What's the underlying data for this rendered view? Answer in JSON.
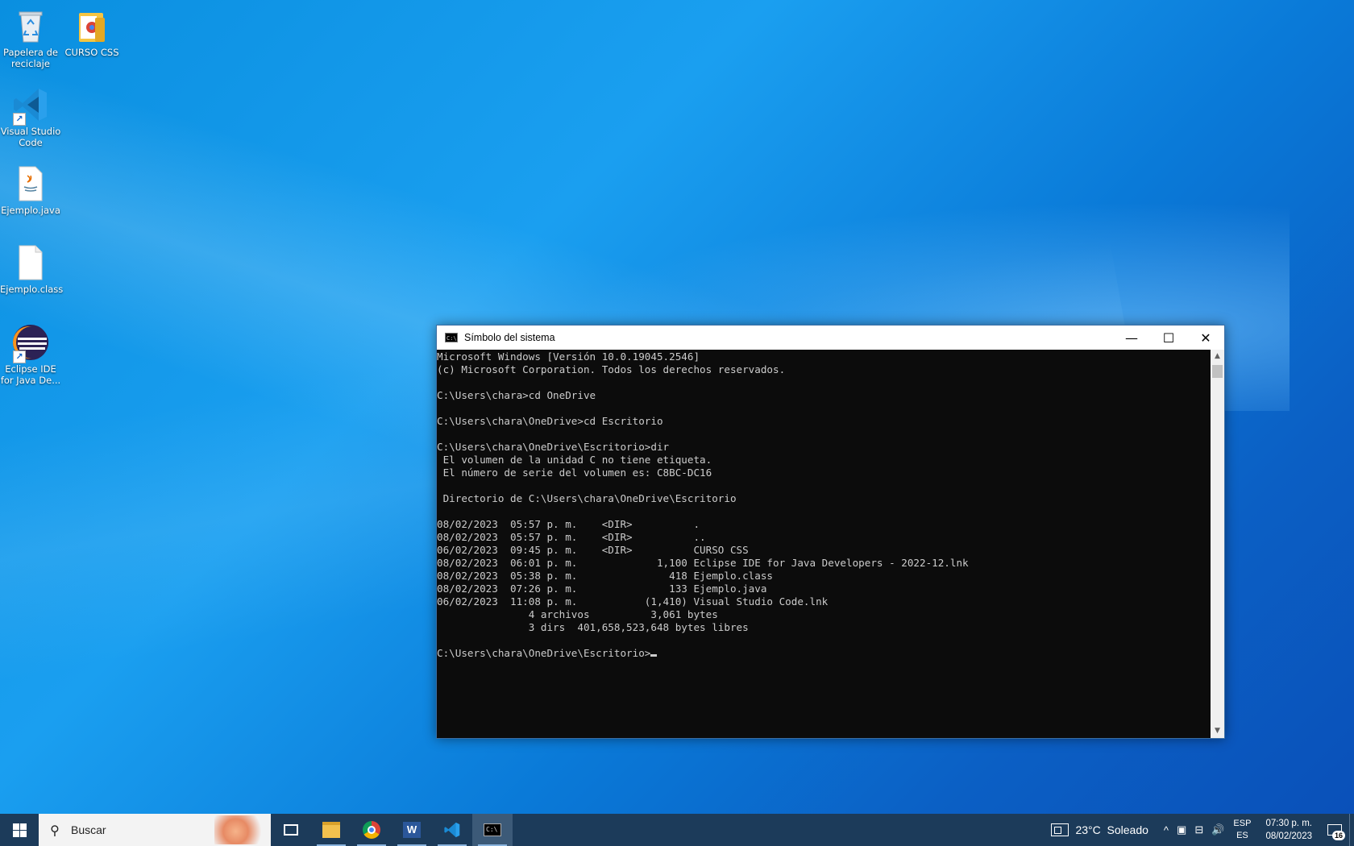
{
  "desktop": {
    "icons": [
      {
        "label": "Papelera de reciclaje",
        "icon": "recycle-bin-icon"
      },
      {
        "label": "CURSO CSS",
        "icon": "folder-icon"
      },
      {
        "label": "Visual Studio Code",
        "icon": "vscode-icon"
      },
      {
        "label": "Ejemplo.java",
        "icon": "java-file-icon"
      },
      {
        "label": "Ejemplo.class",
        "icon": "file-icon"
      },
      {
        "label": "Eclipse IDE for Java De...",
        "icon": "eclipse-icon"
      }
    ]
  },
  "cmd_window": {
    "title": "Símbolo del sistema",
    "minimize_glyph": "—",
    "maximize_glyph": "☐",
    "close_glyph": "✕",
    "lines": [
      "Microsoft Windows [Versión 10.0.19045.2546]",
      "(c) Microsoft Corporation. Todos los derechos reservados.",
      "",
      "C:\\Users\\chara>cd OneDrive",
      "",
      "C:\\Users\\chara\\OneDrive>cd Escritorio",
      "",
      "C:\\Users\\chara\\OneDrive\\Escritorio>dir",
      " El volumen de la unidad C no tiene etiqueta.",
      " El número de serie del volumen es: C8BC-DC16",
      "",
      " Directorio de C:\\Users\\chara\\OneDrive\\Escritorio",
      "",
      "08/02/2023  05:57 p. m.    <DIR>          .",
      "08/02/2023  05:57 p. m.    <DIR>          ..",
      "06/02/2023  09:45 p. m.    <DIR>          CURSO CSS",
      "08/02/2023  06:01 p. m.             1,100 Eclipse IDE for Java Developers - 2022-12.lnk",
      "08/02/2023  05:38 p. m.               418 Ejemplo.class",
      "08/02/2023  07:26 p. m.               133 Ejemplo.java",
      "06/02/2023  11:08 p. m.           (1,410) Visual Studio Code.lnk",
      "               4 archivos          3,061 bytes",
      "               3 dirs  401,658,523,648 bytes libres",
      ""
    ],
    "prompt": "C:\\Users\\chara\\OneDrive\\Escritorio>",
    "scroll_up_glyph": "▲",
    "scroll_down_glyph": "▼"
  },
  "taskbar": {
    "search_placeholder": "Buscar",
    "apps": [
      {
        "name": "task-view-icon"
      },
      {
        "name": "file-explorer-icon"
      },
      {
        "name": "chrome-icon"
      },
      {
        "name": "word-icon"
      },
      {
        "name": "vscode-icon"
      },
      {
        "name": "command-prompt-icon",
        "active": true
      }
    ],
    "weather": {
      "temp": "23°C",
      "condition": "Soleado"
    },
    "lang_top": "ESP",
    "lang_bottom": "ES",
    "time": "07:30 p. m.",
    "date": "08/02/2023",
    "notifications_count": "16"
  }
}
